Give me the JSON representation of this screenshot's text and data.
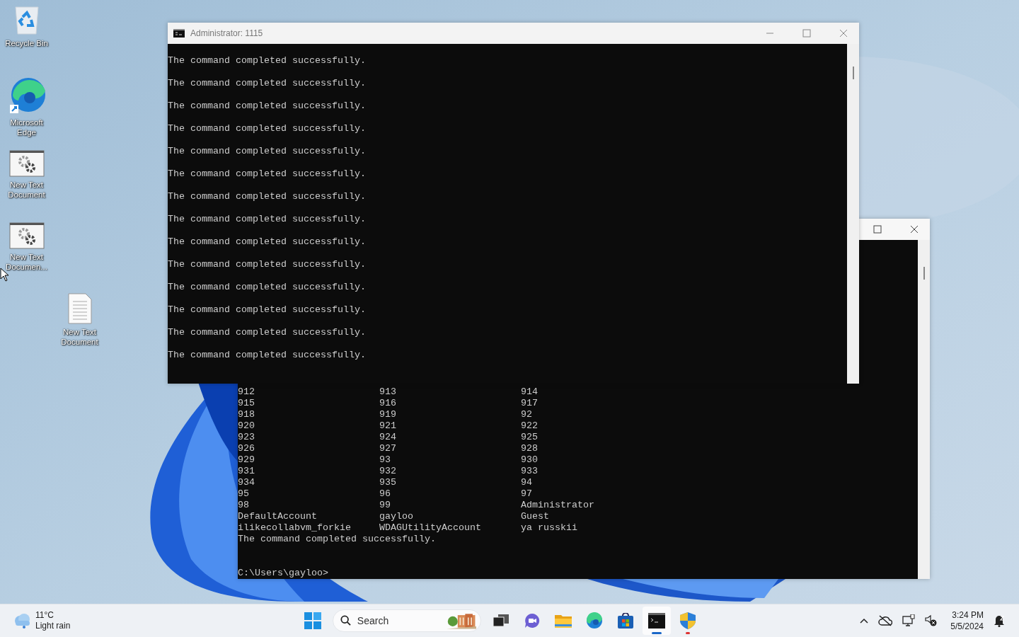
{
  "desktop_icons": [
    {
      "label": "Recycle Bin",
      "kind": "recycle"
    },
    {
      "label": "Microsoft Edge",
      "kind": "edge"
    },
    {
      "label": "New Text Document",
      "kind": "settings"
    },
    {
      "label": "New Text Documen...",
      "kind": "settings"
    },
    {
      "label": "New Text Document",
      "kind": "text"
    }
  ],
  "back_window": {
    "rows": [
      [
        "912",
        "913",
        "914"
      ],
      [
        "915",
        "916",
        "917"
      ],
      [
        "918",
        "919",
        "92"
      ],
      [
        "920",
        "921",
        "922"
      ],
      [
        "923",
        "924",
        "925"
      ],
      [
        "926",
        "927",
        "928"
      ],
      [
        "929",
        "93",
        "930"
      ],
      [
        "931",
        "932",
        "933"
      ],
      [
        "934",
        "935",
        "94"
      ],
      [
        "95",
        "96",
        "97"
      ],
      [
        "98",
        "99",
        "Administrator"
      ],
      [
        "DefaultAccount",
        "gayloo",
        "Guest"
      ],
      [
        "ilikecollabvm_forkie",
        "WDAGUtilityAccount",
        "ya russkii"
      ]
    ],
    "message": "The command completed successfully.",
    "prompt": "C:\\Users\\gayloo>"
  },
  "front_window": {
    "title": "Administrator:  1115",
    "lines": [
      "The command completed successfully.",
      "The command completed successfully.",
      "The command completed successfully.",
      "The command completed successfully.",
      "The command completed successfully.",
      "The command completed successfully.",
      "The command completed successfully.",
      "The command completed successfully.",
      "The command completed successfully.",
      "The command completed successfully.",
      "The command completed successfully.",
      "The command completed successfully.",
      "The command completed successfully.",
      "The command completed successfully."
    ]
  },
  "taskbar": {
    "weather": {
      "temperature": "11°C",
      "condition": "Light rain"
    },
    "search": {
      "placeholder": "Search"
    },
    "apps": [
      {
        "kind": "start",
        "active": false,
        "alert": false
      },
      {
        "kind": "taskview",
        "active": false,
        "alert": false
      },
      {
        "kind": "chat",
        "active": false,
        "alert": false
      },
      {
        "kind": "folder",
        "active": false,
        "alert": false
      },
      {
        "kind": "edge",
        "active": false,
        "alert": false
      },
      {
        "kind": "store",
        "active": false,
        "alert": false
      },
      {
        "kind": "terminal",
        "active": true,
        "alert": false
      },
      {
        "kind": "shield",
        "active": false,
        "alert": true
      }
    ],
    "clock": {
      "time": "3:24 PM",
      "date": "5/5/2024"
    }
  }
}
